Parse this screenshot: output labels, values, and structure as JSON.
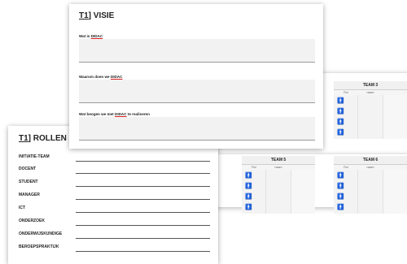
{
  "visie": {
    "title_prefix": "T1",
    "title_suffix": "] VISIE",
    "questions": [
      {
        "text": "Wat is ",
        "highlight": "DIDAC",
        "rest": ""
      },
      {
        "text": "Waarom doen we ",
        "highlight": "DIDAC",
        "rest": ""
      },
      {
        "text": "Wat beogen we met ",
        "highlight": "DIDAC",
        "rest": " te realiseren"
      }
    ]
  },
  "rollen": {
    "title_prefix": "T1",
    "title_suffix": "] ROLLEN",
    "roles": [
      "INITIATIE-TEAM",
      "DOCENT",
      "STUDENT",
      "MANAGER",
      "ICT",
      "ONDERZOEK",
      "ONDERWIJSKUNDIGE",
      "BEROEPSPRAKTIJK"
    ]
  },
  "teams": {
    "col_rol": "Rol",
    "col_naam": "naam",
    "team3": "TEAM 3",
    "team5": "TEAM 5",
    "team6": "TEAM 6",
    "person_glyph": "🚹"
  }
}
